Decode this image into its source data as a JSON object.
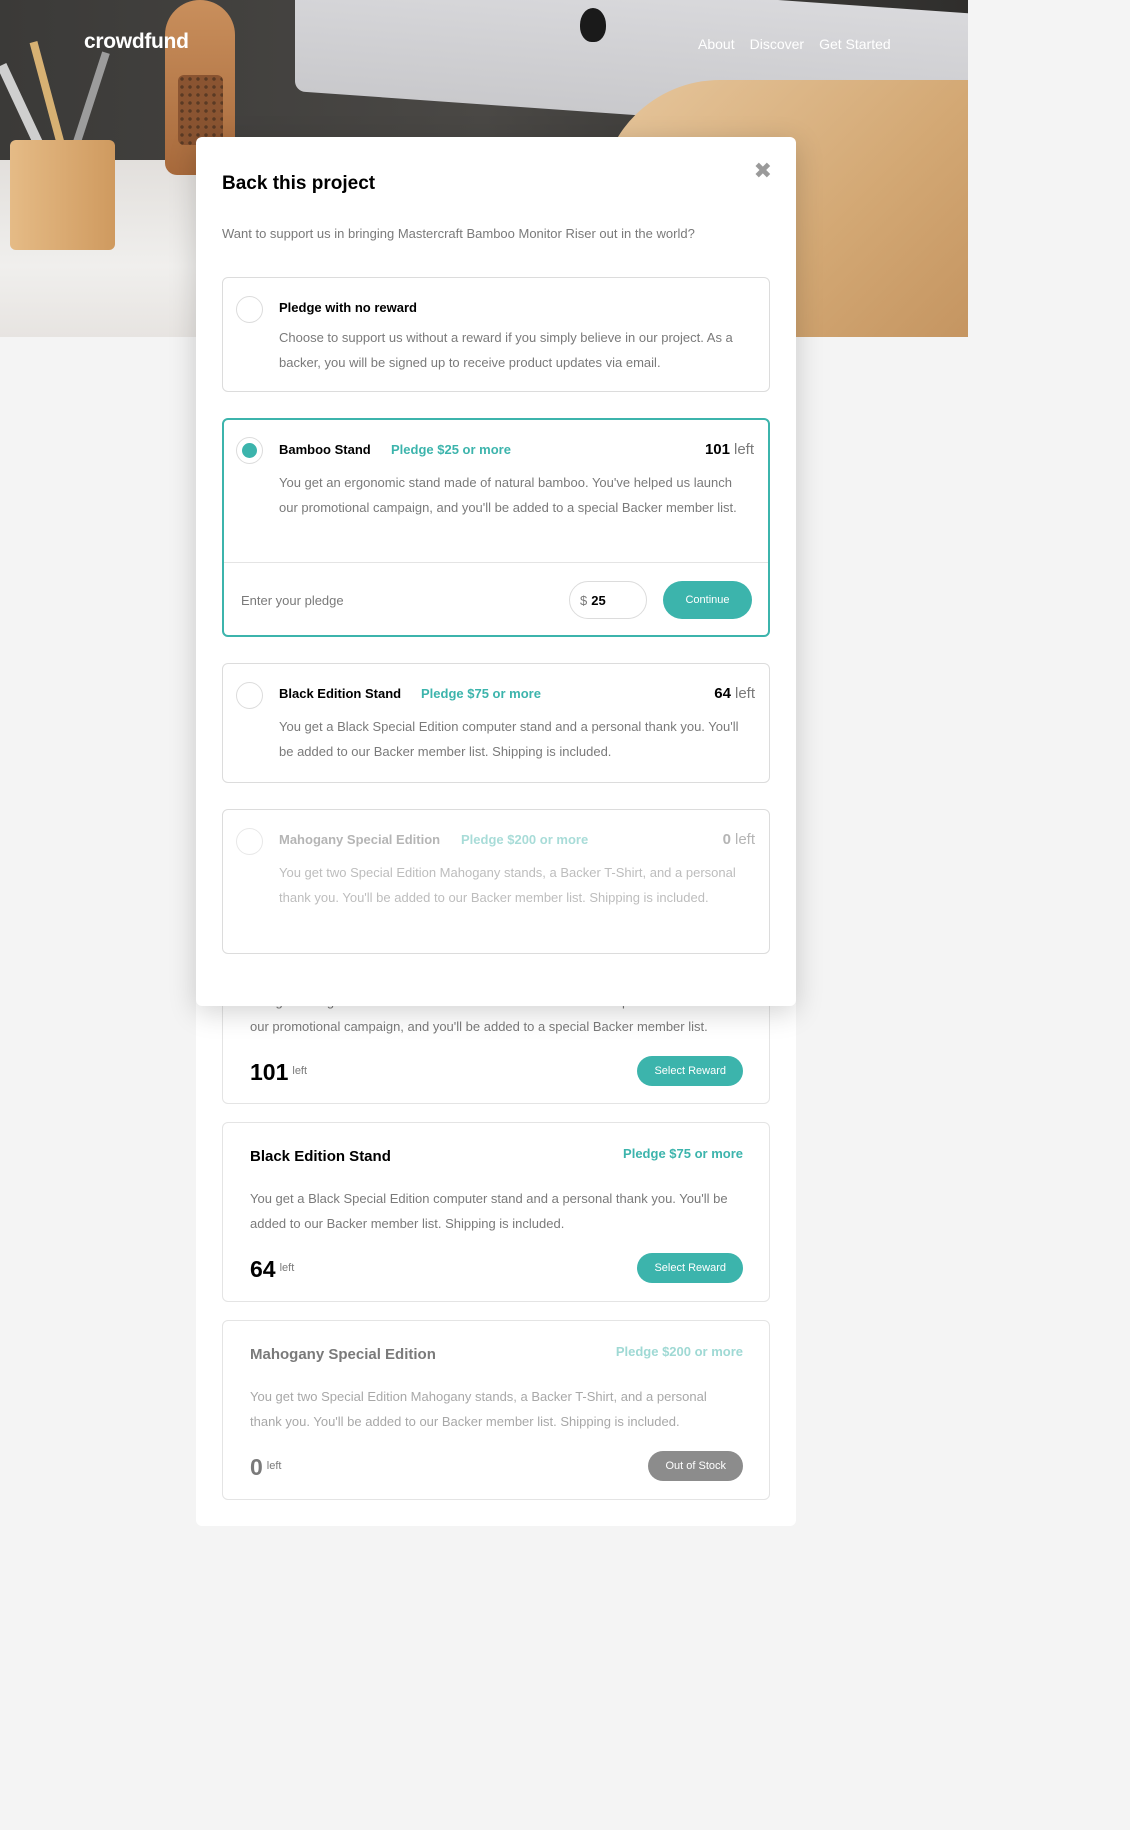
{
  "brand": {
    "logo": "crowdfund",
    "accent": "#3cb4ac"
  },
  "nav": {
    "items": [
      "About",
      "Discover",
      "Get Started"
    ]
  },
  "modal": {
    "title": "Back this project",
    "close_icon": "close-icon",
    "intro": "Want to support us in bringing Mastercraft Bamboo Monitor Riser out in the world?",
    "options": [
      {
        "title": "Pledge with no reward",
        "desc": "Choose to support us without a reward if you simply believe in our project. As a backer, you will be signed up to receive product updates via email.",
        "selected": false
      },
      {
        "title": "Bamboo Stand",
        "pledge": "Pledge $25 or more",
        "count": "101",
        "left": "left",
        "desc": "You get an ergonomic stand made of natural bamboo. You've helped us launch our promotional campaign, and you'll be added to a special Backer member list.",
        "selected": true,
        "enter_label": "Enter your pledge",
        "currency": "$",
        "amount": "25",
        "continue_label": "Continue"
      },
      {
        "title": "Black Edition Stand",
        "pledge": "Pledge $75 or more",
        "count": "64",
        "left": "left",
        "desc": "You get a Black Special Edition computer stand and a personal thank you. You'll be added to our Backer member list. Shipping is included.",
        "selected": false
      },
      {
        "title": "Mahogany Special Edition",
        "pledge": "Pledge $200 or more",
        "count": "0",
        "left": "left",
        "desc": "You get two Special Edition Mahogany stands, a Backer T-Shirt, and a personal thank you. You'll be added to our Backer member list. Shipping is included.",
        "selected": false,
        "disabled": true
      }
    ]
  },
  "rewards": [
    {
      "desc_partial": "You get an ergonomic stand made of natural bamboo. You've helped us launch",
      "desc_visible": "our promotional campaign, and you'll be added to a special Backer member list.",
      "count": "101",
      "left": "left",
      "button": "Select Reward"
    },
    {
      "title": "Black Edition Stand",
      "pledge": "Pledge $75 or more",
      "desc": "You get a Black Special Edition computer stand and a personal thank you. You'll be added to our Backer member list. Shipping is included.",
      "count": "64",
      "left": "left",
      "button": "Select Reward"
    },
    {
      "title": "Mahogany Special Edition",
      "pledge": "Pledge $200 or more",
      "desc": "You get two Special Edition Mahogany stands, a Backer T-Shirt, and a personal thank you. You'll be added to our Backer member list. Shipping is included.",
      "count": "0",
      "left": "left",
      "button": "Out of Stock"
    }
  ]
}
